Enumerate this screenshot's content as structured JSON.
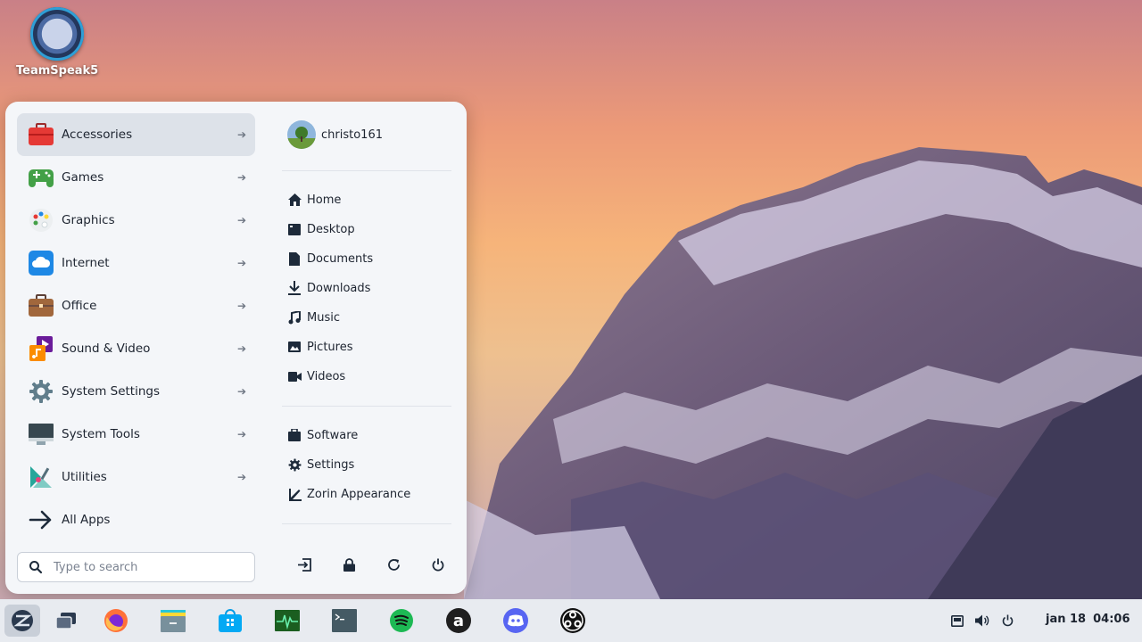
{
  "desktop": {
    "icon_label": "TeamSpeak5"
  },
  "menu": {
    "categories": [
      {
        "label": "Accessories",
        "icon": "toolbox-icon"
      },
      {
        "label": "Games",
        "icon": "gamepad-icon"
      },
      {
        "label": "Graphics",
        "icon": "palette-icon"
      },
      {
        "label": "Internet",
        "icon": "cloud-icon"
      },
      {
        "label": "Office",
        "icon": "briefcase-icon"
      },
      {
        "label": "Sound & Video",
        "icon": "media-icon"
      },
      {
        "label": "System Settings",
        "icon": "gear-icon"
      },
      {
        "label": "System Tools",
        "icon": "monitor-icon"
      },
      {
        "label": "Utilities",
        "icon": "utilities-icon"
      },
      {
        "label": "All Apps",
        "icon": "arrow-right-icon"
      }
    ],
    "search_placeholder": "Type to search",
    "user": {
      "name": "christo161"
    },
    "places": [
      "Home",
      "Desktop",
      "Documents",
      "Downloads",
      "Music",
      "Pictures",
      "Videos"
    ],
    "system_links": [
      "Software",
      "Settings",
      "Zorin Appearance"
    ]
  },
  "taskbar": {
    "date": "jan 18",
    "time": "04:06"
  },
  "colors": {
    "accent": "#15aabf",
    "menu_bg": "#f4f6f9",
    "active_row": "#dde2e9"
  }
}
